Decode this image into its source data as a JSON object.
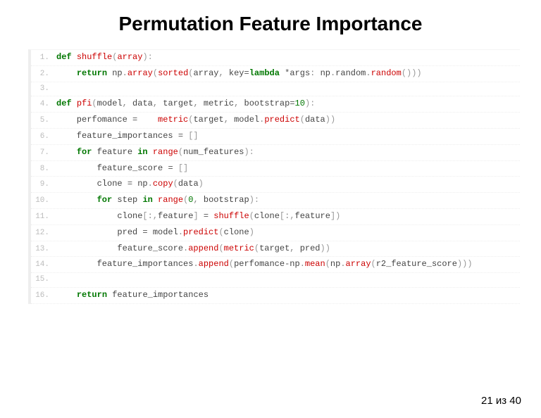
{
  "title": "Permutation Feature Importance",
  "pager": "21 из 40",
  "code": {
    "lines": [
      {
        "n": "1.",
        "tokens": [
          [
            "kw",
            "def "
          ],
          [
            "fn",
            "shuffle"
          ],
          [
            "paren",
            "("
          ],
          [
            "fn",
            "array"
          ],
          [
            "paren",
            "):"
          ]
        ]
      },
      {
        "n": "2.",
        "tokens": [
          [
            "id",
            "    "
          ],
          [
            "kw",
            "return "
          ],
          [
            "id",
            "np"
          ],
          [
            "punc",
            "."
          ],
          [
            "fn",
            "array"
          ],
          [
            "paren",
            "("
          ],
          [
            "fn",
            "sorted"
          ],
          [
            "paren",
            "("
          ],
          [
            "id",
            "array"
          ],
          [
            "punc",
            ", "
          ],
          [
            "id",
            "key"
          ],
          [
            "eq",
            "="
          ],
          [
            "kw",
            "lambda "
          ],
          [
            "op",
            "*"
          ],
          [
            "id",
            "args"
          ],
          [
            "punc",
            ": "
          ],
          [
            "id",
            "np"
          ],
          [
            "punc",
            "."
          ],
          [
            "id",
            "random"
          ],
          [
            "punc",
            "."
          ],
          [
            "fn",
            "random"
          ],
          [
            "paren",
            "()))"
          ]
        ]
      },
      {
        "n": "3.",
        "tokens": [
          [
            "id",
            ""
          ]
        ]
      },
      {
        "n": "4.",
        "tokens": [
          [
            "kw",
            "def "
          ],
          [
            "fn",
            "pfi"
          ],
          [
            "paren",
            "("
          ],
          [
            "id",
            "model"
          ],
          [
            "punc",
            ", "
          ],
          [
            "id",
            "data"
          ],
          [
            "punc",
            ", "
          ],
          [
            "id",
            "target"
          ],
          [
            "punc",
            ", "
          ],
          [
            "id",
            "metric"
          ],
          [
            "punc",
            ", "
          ],
          [
            "id",
            "bootstrap"
          ],
          [
            "eq",
            "="
          ],
          [
            "num",
            "10"
          ],
          [
            "paren",
            "):"
          ]
        ]
      },
      {
        "n": "5.",
        "tokens": [
          [
            "id",
            "    perfomance "
          ],
          [
            "eq",
            "="
          ],
          [
            "id",
            "    "
          ],
          [
            "fn",
            "metric"
          ],
          [
            "paren",
            "("
          ],
          [
            "id",
            "target"
          ],
          [
            "punc",
            ", "
          ],
          [
            "id",
            "model"
          ],
          [
            "punc",
            "."
          ],
          [
            "fn",
            "predict"
          ],
          [
            "paren",
            "("
          ],
          [
            "id",
            "data"
          ],
          [
            "paren",
            "))"
          ]
        ]
      },
      {
        "n": "6.",
        "tokens": [
          [
            "id",
            "    feature_importances "
          ],
          [
            "eq",
            "="
          ],
          [
            "id",
            " "
          ],
          [
            "paren",
            "[]"
          ]
        ]
      },
      {
        "n": "7.",
        "tokens": [
          [
            "id",
            "    "
          ],
          [
            "kw",
            "for "
          ],
          [
            "id",
            "feature "
          ],
          [
            "kw",
            "in "
          ],
          [
            "fn",
            "range"
          ],
          [
            "paren",
            "("
          ],
          [
            "id",
            "num_features"
          ],
          [
            "paren",
            "):"
          ]
        ]
      },
      {
        "n": "8.",
        "tokens": [
          [
            "id",
            "        feature_score "
          ],
          [
            "eq",
            "="
          ],
          [
            "id",
            " "
          ],
          [
            "paren",
            "[]"
          ]
        ]
      },
      {
        "n": "9.",
        "tokens": [
          [
            "id",
            "        clone "
          ],
          [
            "eq",
            "="
          ],
          [
            "id",
            " np"
          ],
          [
            "punc",
            "."
          ],
          [
            "fn",
            "copy"
          ],
          [
            "paren",
            "("
          ],
          [
            "id",
            "data"
          ],
          [
            "paren",
            ")"
          ]
        ]
      },
      {
        "n": "10.",
        "tokens": [
          [
            "id",
            "        "
          ],
          [
            "kw",
            "for "
          ],
          [
            "id",
            "step "
          ],
          [
            "kw",
            "in "
          ],
          [
            "fn",
            "range"
          ],
          [
            "paren",
            "("
          ],
          [
            "num",
            "0"
          ],
          [
            "punc",
            ", "
          ],
          [
            "id",
            "bootstrap"
          ],
          [
            "paren",
            "):"
          ]
        ]
      },
      {
        "n": "11.",
        "tokens": [
          [
            "id",
            "            clone"
          ],
          [
            "paren",
            "["
          ],
          [
            "punc",
            ":"
          ],
          [
            "paren",
            ","
          ],
          [
            "id",
            "feature"
          ],
          [
            "paren",
            "] "
          ],
          [
            "eq",
            "="
          ],
          [
            "id",
            " "
          ],
          [
            "fn",
            "shuffle"
          ],
          [
            "paren",
            "("
          ],
          [
            "id",
            "clone"
          ],
          [
            "paren",
            "["
          ],
          [
            "punc",
            ":"
          ],
          [
            "paren",
            ","
          ],
          [
            "id",
            "feature"
          ],
          [
            "paren",
            "])"
          ]
        ]
      },
      {
        "n": "12.",
        "tokens": [
          [
            "id",
            "            pred "
          ],
          [
            "eq",
            "="
          ],
          [
            "id",
            " model"
          ],
          [
            "punc",
            "."
          ],
          [
            "fn",
            "predict"
          ],
          [
            "paren",
            "("
          ],
          [
            "id",
            "clone"
          ],
          [
            "paren",
            ")"
          ]
        ]
      },
      {
        "n": "13.",
        "tokens": [
          [
            "id",
            "            feature_score"
          ],
          [
            "punc",
            "."
          ],
          [
            "fn",
            "append"
          ],
          [
            "paren",
            "("
          ],
          [
            "fn",
            "metric"
          ],
          [
            "paren",
            "("
          ],
          [
            "id",
            "target"
          ],
          [
            "punc",
            ", "
          ],
          [
            "id",
            "pred"
          ],
          [
            "paren",
            "))"
          ]
        ]
      },
      {
        "n": "14.",
        "tokens": [
          [
            "id",
            "        feature_importances"
          ],
          [
            "punc",
            "."
          ],
          [
            "fn",
            "append"
          ],
          [
            "paren",
            "("
          ],
          [
            "id",
            "perfomance"
          ],
          [
            "op",
            "-"
          ],
          [
            "id",
            "np"
          ],
          [
            "punc",
            "."
          ],
          [
            "fn",
            "mean"
          ],
          [
            "paren",
            "("
          ],
          [
            "id",
            "np"
          ],
          [
            "punc",
            "."
          ],
          [
            "fn",
            "array"
          ],
          [
            "paren",
            "("
          ],
          [
            "id",
            "r2_feature_score"
          ],
          [
            "paren",
            ")))"
          ]
        ]
      },
      {
        "n": "15.",
        "tokens": [
          [
            "id",
            ""
          ]
        ]
      },
      {
        "n": "16.",
        "tokens": [
          [
            "id",
            "    "
          ],
          [
            "kw",
            "return "
          ],
          [
            "id",
            "feature_importances"
          ]
        ]
      }
    ]
  }
}
